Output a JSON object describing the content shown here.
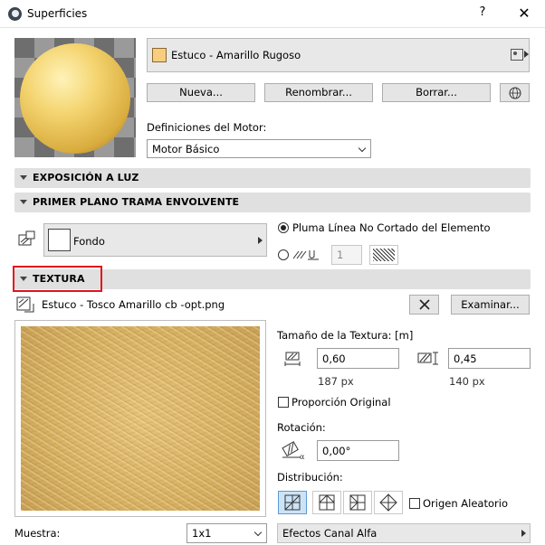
{
  "window": {
    "title": "Superficies",
    "help": "?",
    "close": "✕"
  },
  "surface": {
    "name": "Estuco - Amarillo Rugoso",
    "swatch_color": "#f9cd7e"
  },
  "actions": {
    "new": "Nueva...",
    "rename": "Renombrar...",
    "delete": "Borrar..."
  },
  "engine": {
    "label": "Definiciones del Motor:",
    "value": "Motor Básico"
  },
  "sections": {
    "exposure": "EXPOSICIÓN A LUZ",
    "foreground": "PRIMER PLANO TRAMA ENVOLVENTE",
    "texture": "TEXTURA"
  },
  "fill": {
    "name": "Fondo",
    "pen_option": "Pluma Línea No Cortado del Elemento",
    "pen_number": "1"
  },
  "texture": {
    "filename": "Estuco - Tosco Amarillo cb -opt.png",
    "browse": "Examinar...",
    "size_label": "Tamaño de la Textura: [m]",
    "width": "0,60",
    "height": "0,45",
    "width_px": "187 px",
    "height_px": "140 px",
    "proportion": "Proporción Original",
    "rotation_label": "Rotación:",
    "rotation": "0,00°",
    "distribution_label": "Distribución:",
    "random_origin": "Origen Aleatorio"
  },
  "footer": {
    "sample_label": "Muestra:",
    "sample_value": "1x1",
    "alpha_effects": "Efectos Canal Alfa"
  },
  "colors": {
    "highlight_border": "#e0141e",
    "selection_fill": "#cce3f7"
  }
}
